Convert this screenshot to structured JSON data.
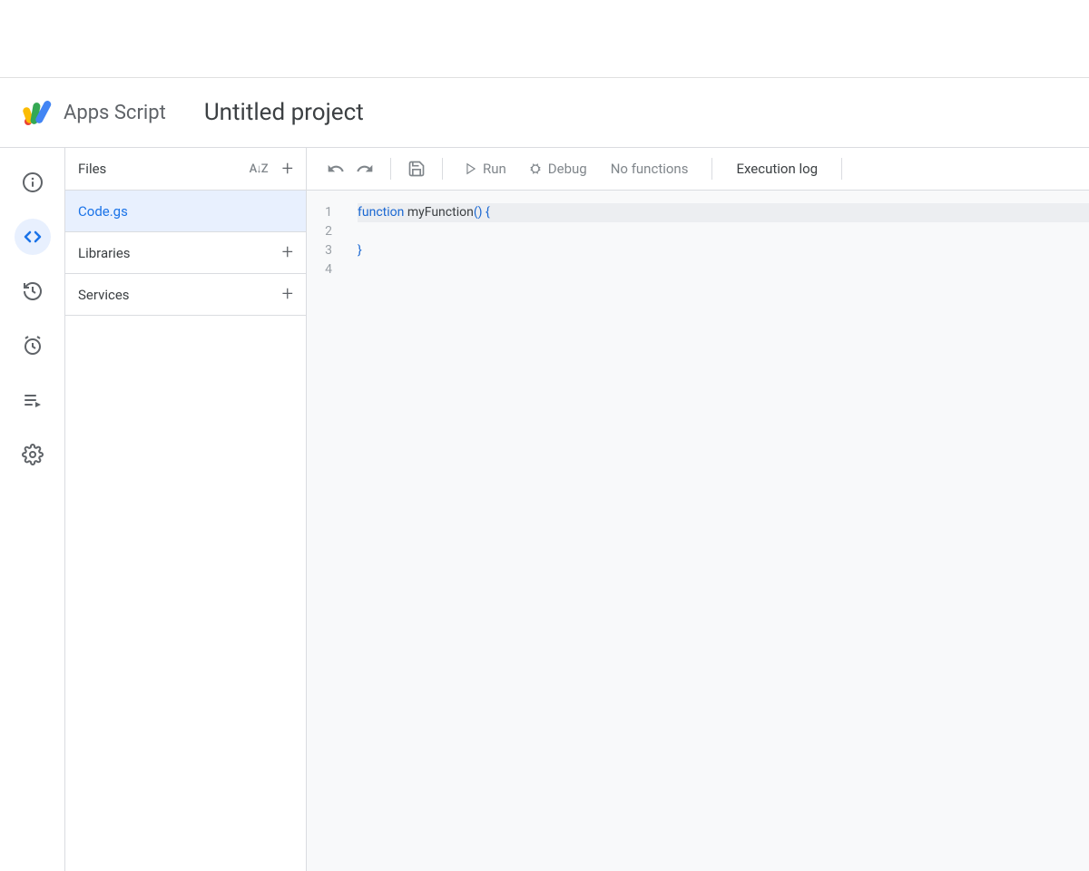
{
  "header": {
    "app_name": "Apps Script",
    "project_title": "Untitled project"
  },
  "file_panel": {
    "title": "Files",
    "selected_file": "Code.gs",
    "libraries_label": "Libraries",
    "services_label": "Services"
  },
  "toolbar": {
    "run_label": "Run",
    "debug_label": "Debug",
    "function_selector": "No functions",
    "execution_log_label": "Execution log"
  },
  "code": {
    "line_numbers": [
      "1",
      "2",
      "3",
      "4"
    ],
    "tokens": {
      "keyword_function": "function",
      "function_name": "myFunction",
      "open_paren": "(",
      "close_paren": ")",
      "open_brace": "{",
      "close_brace": "}"
    }
  }
}
